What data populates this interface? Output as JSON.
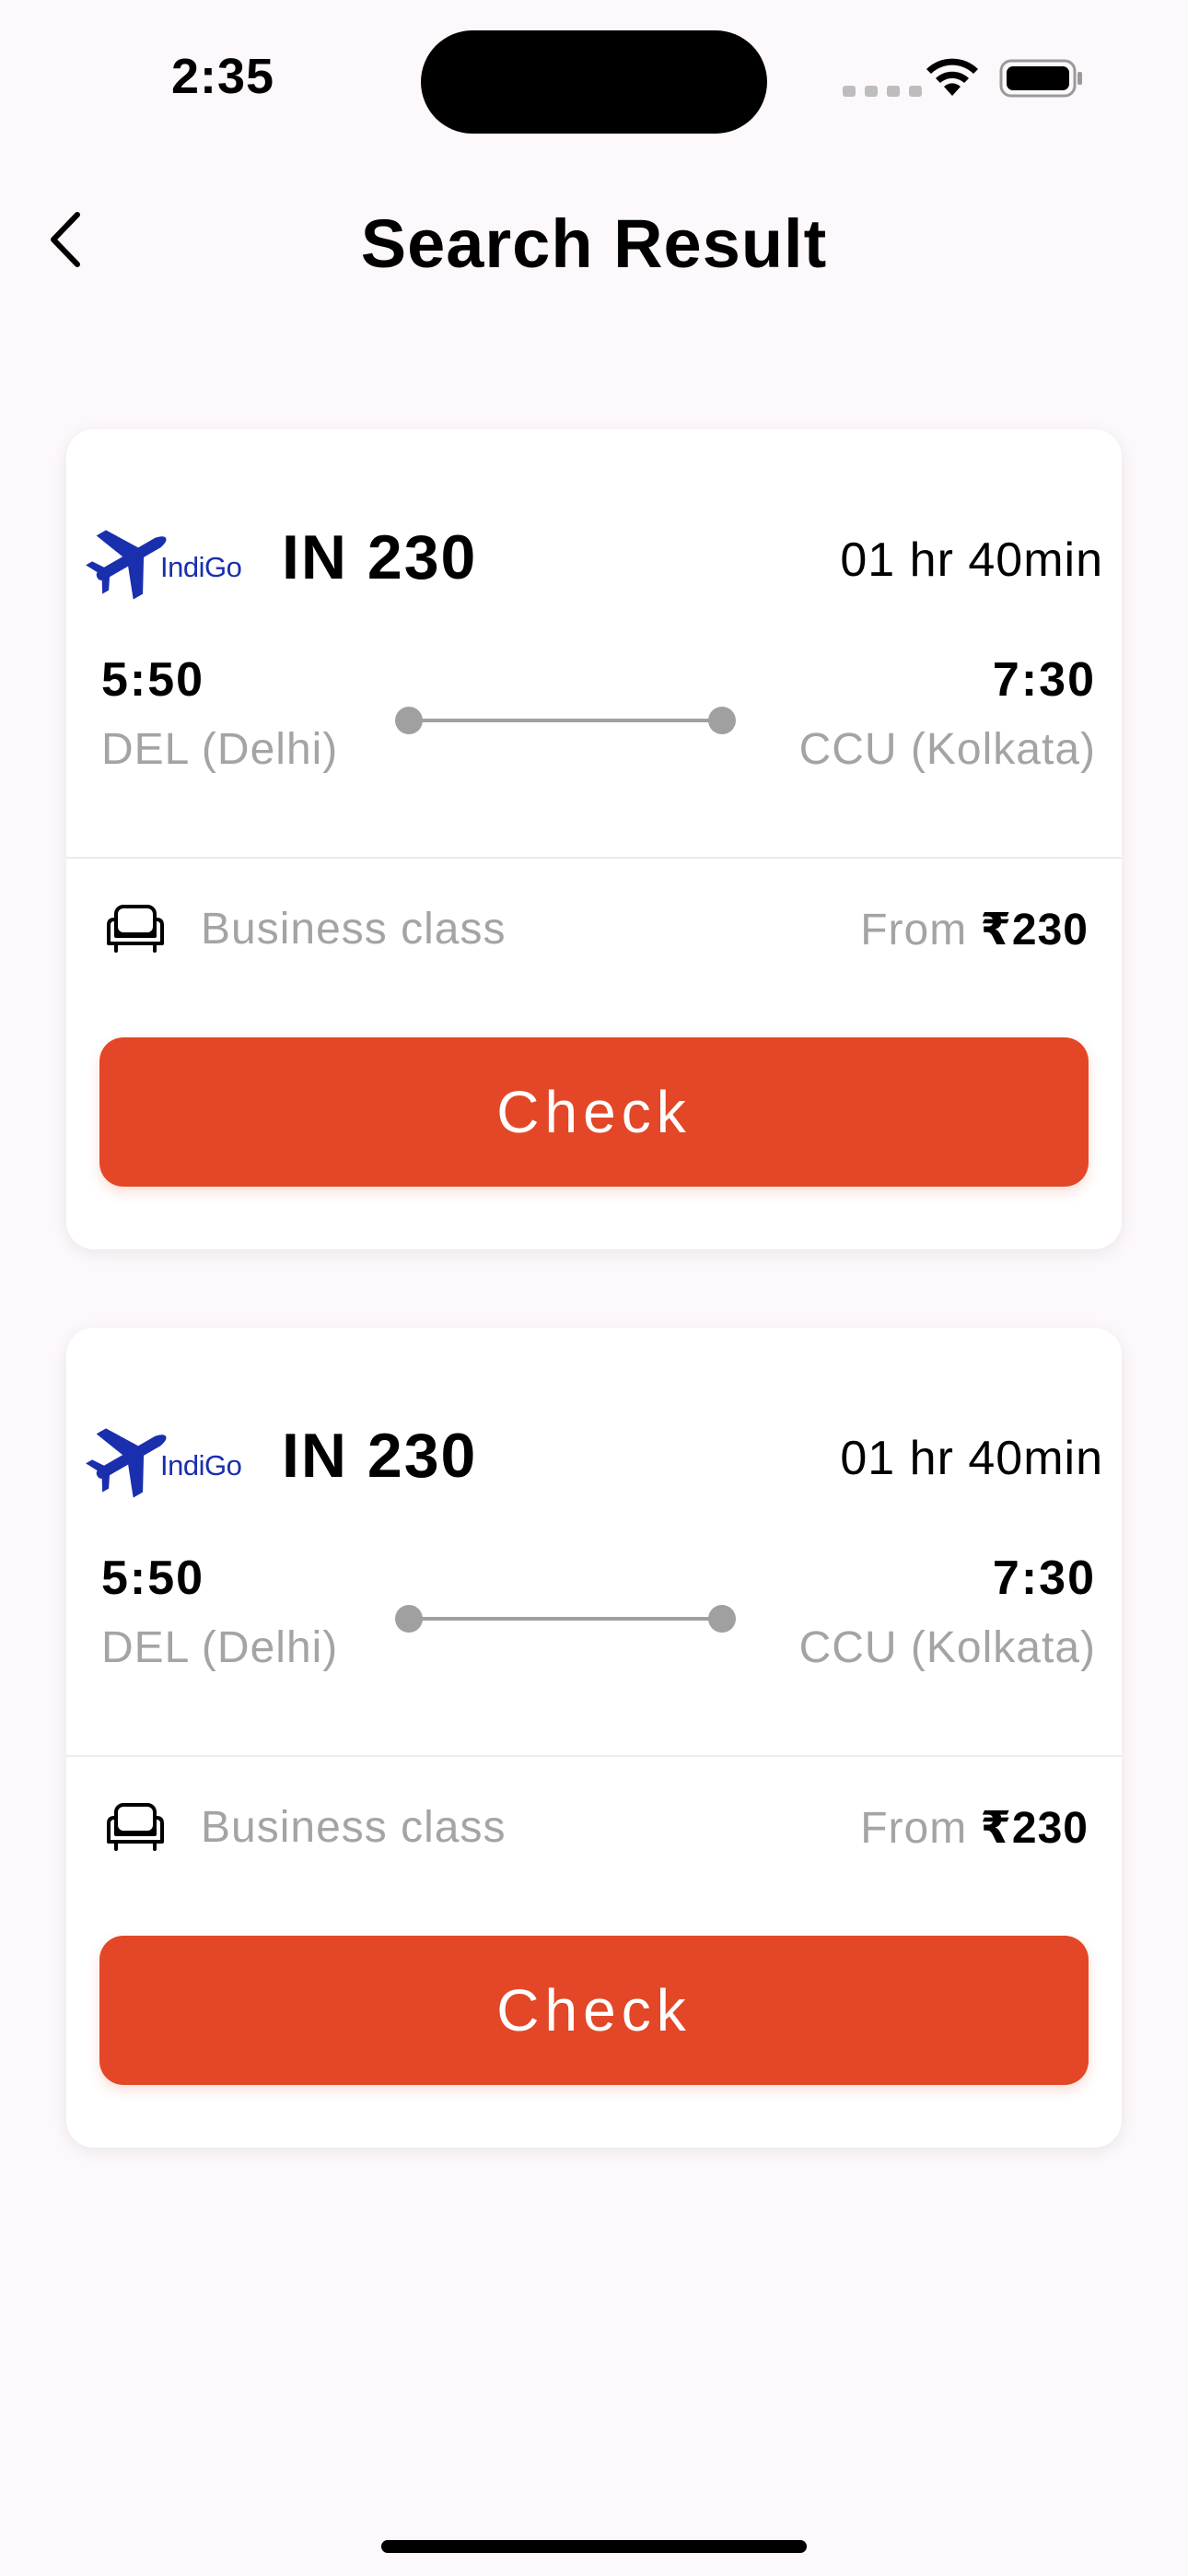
{
  "status_bar": {
    "time": "2:35"
  },
  "header": {
    "title": "Search Result",
    "back_icon": "chevron-left-icon"
  },
  "colors": {
    "accent": "#e34727",
    "background": "#fdf8fb",
    "muted_text": "#a4a4a4",
    "logo_blue": "#1a2fae"
  },
  "results": [
    {
      "airline_logo_text": "IndiGo",
      "flight_code": "IN 230",
      "duration": "01 hr 40min",
      "departure_time": "5:50",
      "departure_place": "DEL (Delhi)",
      "arrival_time": "7:30",
      "arrival_place": "CCU (Kolkata)",
      "seat_icon": "seat-icon",
      "travel_class": "Business class",
      "price_prefix": "From",
      "price": "₹230",
      "action_label": "Check"
    },
    {
      "airline_logo_text": "IndiGo",
      "flight_code": "IN 230",
      "duration": "01 hr 40min",
      "departure_time": "5:50",
      "departure_place": "DEL (Delhi)",
      "arrival_time": "7:30",
      "arrival_place": "CCU (Kolkata)",
      "seat_icon": "seat-icon",
      "travel_class": "Business class",
      "price_prefix": "From",
      "price": "₹230",
      "action_label": "Check"
    }
  ]
}
